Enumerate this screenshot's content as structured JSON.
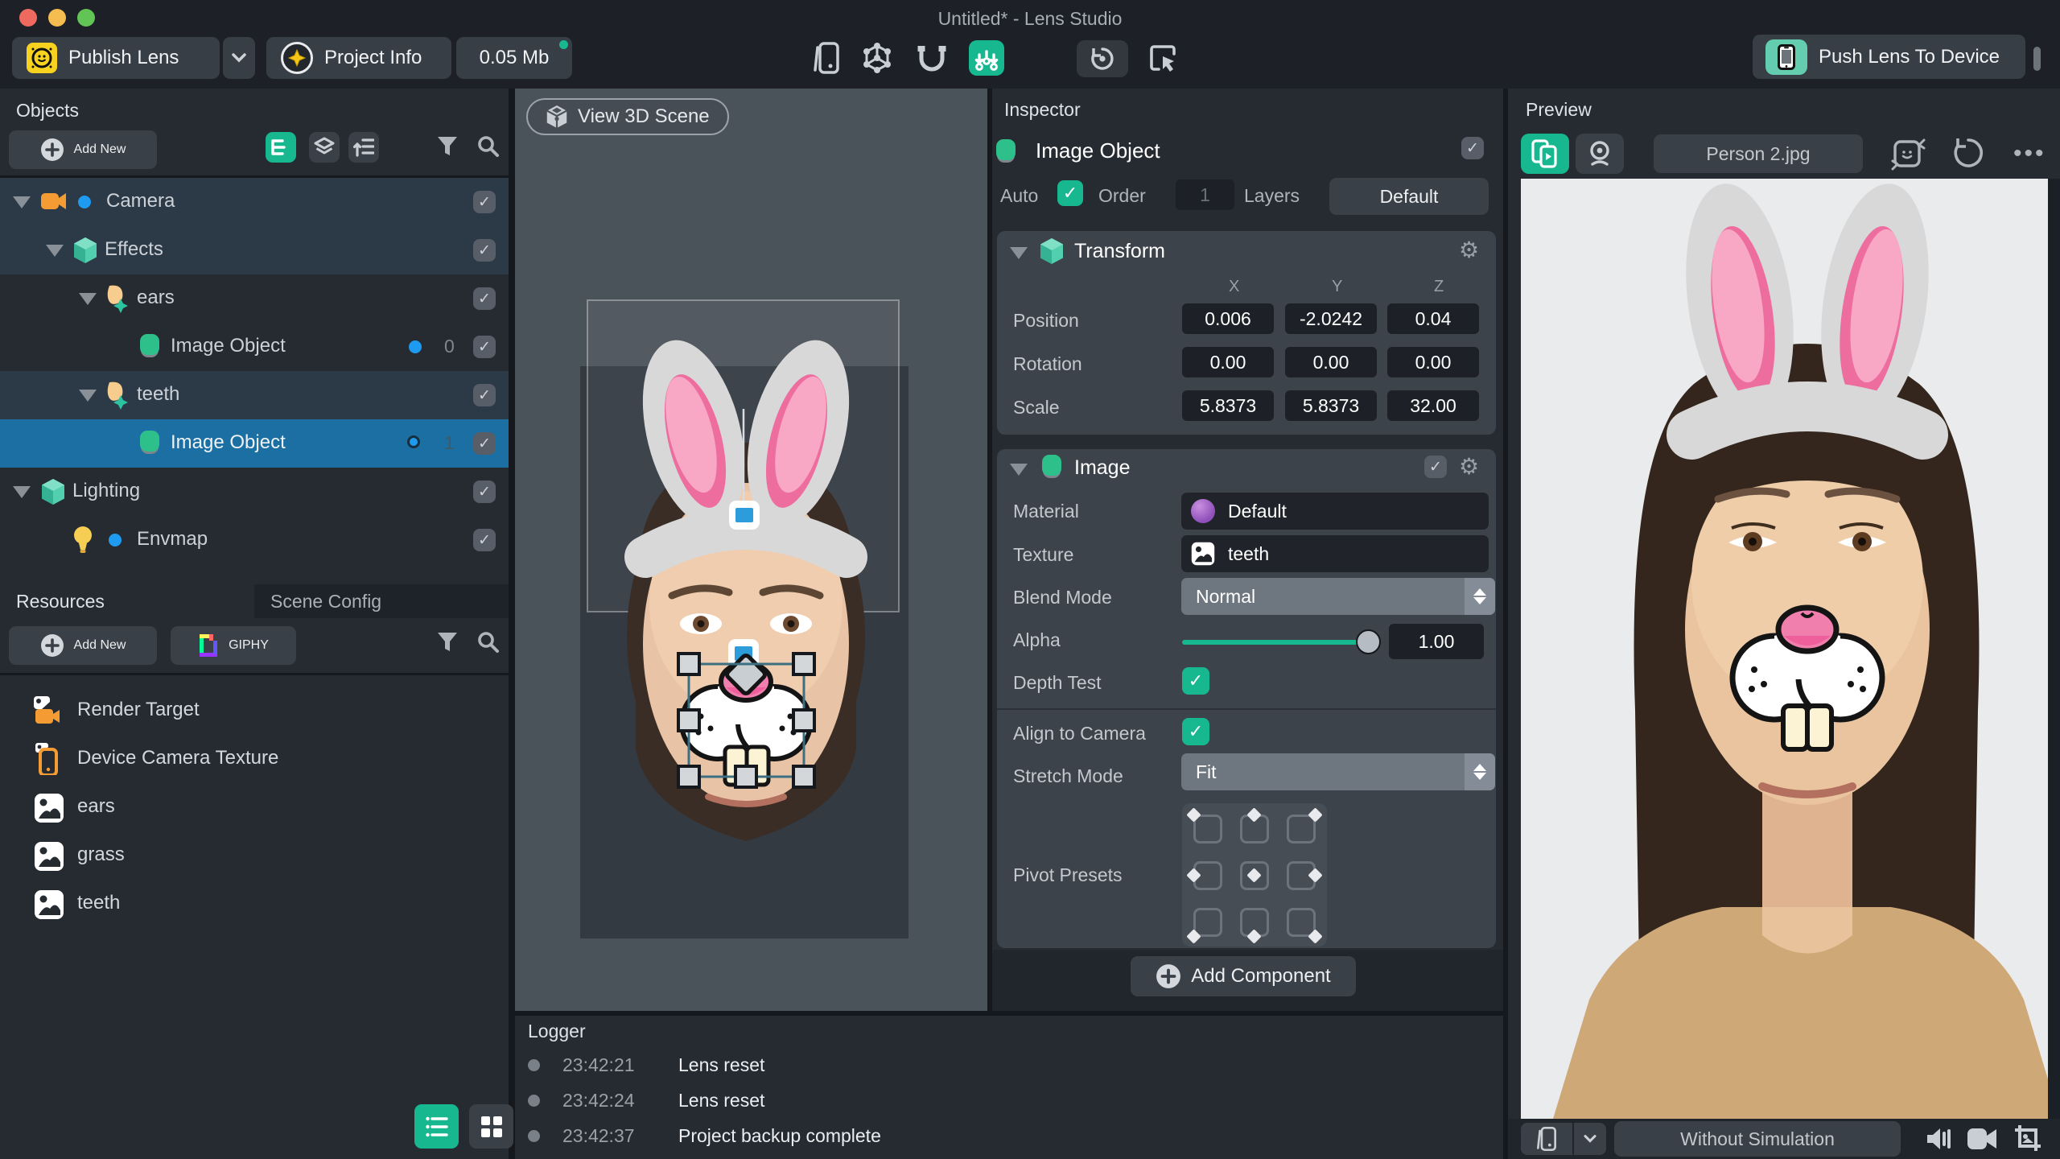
{
  "window": {
    "title": "Untitled* - Lens Studio"
  },
  "toolbar": {
    "publish_label": "Publish Lens",
    "project_info_label": "Project Info",
    "project_size": "0.05 Mb",
    "push_label": "Push Lens To Device"
  },
  "objects_panel": {
    "title": "Objects",
    "add_new_label": "Add New",
    "tree": [
      {
        "label": "Camera"
      },
      {
        "label": "Effects"
      },
      {
        "label": "ears"
      },
      {
        "label": "Image Object",
        "badge": "0"
      },
      {
        "label": "teeth"
      },
      {
        "label": "Image Object",
        "badge": "1"
      },
      {
        "label": "Lighting"
      },
      {
        "label": "Envmap"
      }
    ]
  },
  "resources_panel": {
    "tab_resources": "Resources",
    "tab_scene_config": "Scene Config",
    "add_new_label": "Add New",
    "giphy_label": "GIPHY",
    "items": [
      {
        "label": "Render Target"
      },
      {
        "label": "Device Camera Texture"
      },
      {
        "label": "ears"
      },
      {
        "label": "grass"
      },
      {
        "label": "teeth"
      }
    ]
  },
  "scene": {
    "view_3d_label": "View 3D Scene"
  },
  "inspector": {
    "title": "Inspector",
    "object_name": "Image Object",
    "auto_label": "Auto",
    "order_label": "Order",
    "order_value": "1",
    "layers_label": "Layers",
    "layers_value": "Default",
    "transform": {
      "title": "Transform",
      "axes": [
        "X",
        "Y",
        "Z"
      ],
      "rows": [
        {
          "label": "Position",
          "values": [
            "0.006",
            "-2.0242",
            "0.04"
          ]
        },
        {
          "label": "Rotation",
          "values": [
            "0.00",
            "0.00",
            "0.00"
          ]
        },
        {
          "label": "Scale",
          "values": [
            "5.8373",
            "5.8373",
            "32.00"
          ]
        }
      ]
    },
    "image": {
      "title": "Image",
      "material_label": "Material",
      "material_value": "Default",
      "texture_label": "Texture",
      "texture_value": "teeth",
      "blend_label": "Blend Mode",
      "blend_value": "Normal",
      "alpha_label": "Alpha",
      "alpha_value": "1.00",
      "depth_label": "Depth Test",
      "align_label": "Align to Camera",
      "stretch_label": "Stretch Mode",
      "stretch_value": "Fit",
      "pivot_label": "Pivot Presets"
    },
    "add_component_label": "Add Component"
  },
  "logger": {
    "title": "Logger",
    "entries": [
      {
        "time": "23:42:21",
        "message": "Lens reset"
      },
      {
        "time": "23:42:24",
        "message": "Lens reset"
      },
      {
        "time": "23:42:37",
        "message": "Project backup complete"
      }
    ]
  },
  "preview": {
    "title": "Preview",
    "source_value": "Person 2.jpg",
    "simulation_value": "Without Simulation"
  },
  "colors": {
    "accent_green": "#17b890",
    "selection_blue": "#1b6fa3",
    "dot_blue": "#1e9bf0",
    "orange": "#f49b33",
    "scene_bg": "#4a525a"
  }
}
